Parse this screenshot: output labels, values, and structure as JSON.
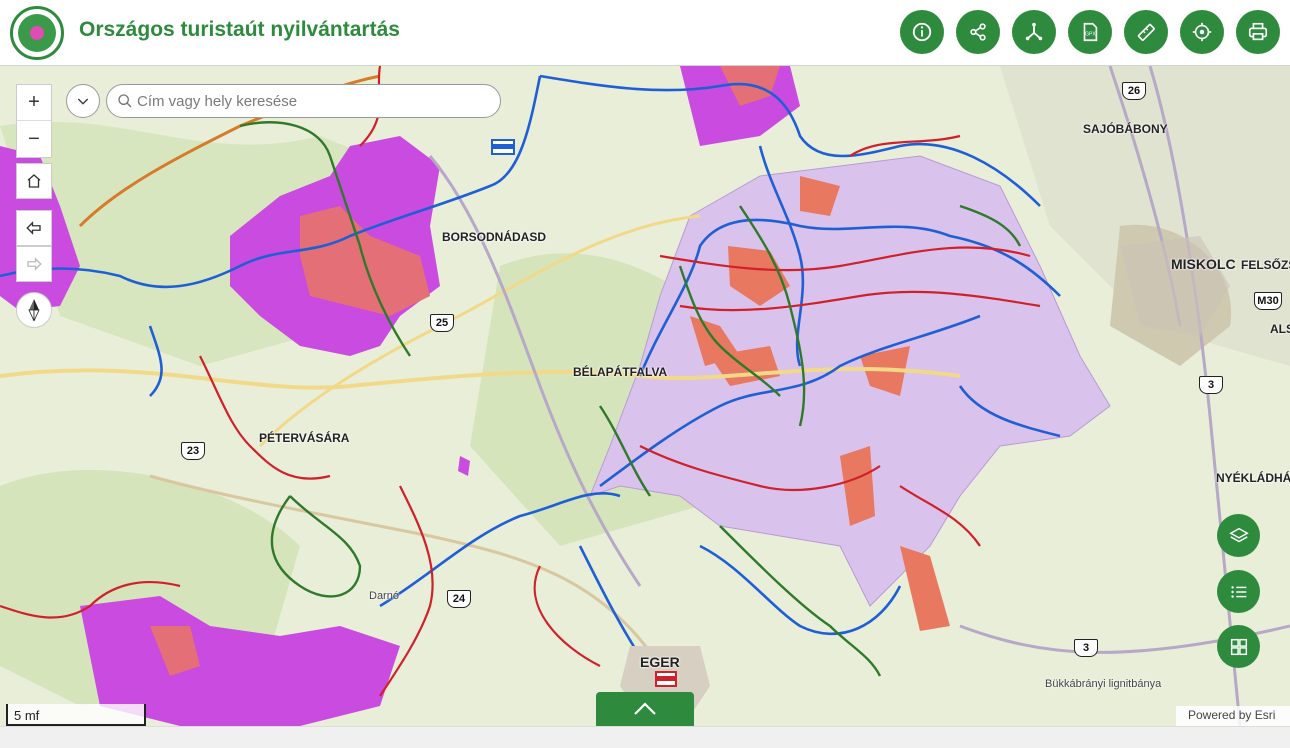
{
  "header": {
    "title": "Országos turistaút nyilvántartás",
    "tools": [
      {
        "name": "info",
        "icon": "info-icon"
      },
      {
        "name": "share",
        "icon": "share-icon"
      },
      {
        "name": "network",
        "icon": "route-network-icon"
      },
      {
        "name": "gpx",
        "icon": "gpx-file-icon",
        "label": "GPX"
      },
      {
        "name": "measure",
        "icon": "ruler-icon"
      },
      {
        "name": "locate",
        "icon": "locate-icon"
      },
      {
        "name": "print",
        "icon": "print-icon"
      }
    ]
  },
  "search": {
    "placeholder": "Cím vagy hely keresése"
  },
  "map_controls": {
    "zoom_in": "+",
    "zoom_out": "−"
  },
  "places": {
    "sajobabony": "SAJÓBÁBONY",
    "borsodnadasd": "BORSODNÁDASD",
    "miskolc": "MISKOLC",
    "felsozs": "FELSŐZS",
    "belapatfalva": "BÉLAPÁTFALVA",
    "petervasara": "PÉTERVÁSÁRA",
    "nyekladhaza": "NYÉKLÁDHÁZ",
    "eger": "EGER",
    "bukkabranyi": "Bükkábrányi lignitbánya",
    "darnó": "Darnó",
    "als": "ALS"
  },
  "roads": {
    "r26": "26",
    "r25": "25",
    "r23": "23",
    "r24": "24",
    "r3a": "3",
    "r3b": "3",
    "m30": "M30"
  },
  "scale": "5 mf",
  "attribution": "Powered by Esri",
  "colors": {
    "brand": "#2e8b3e",
    "trail_blue": "#1f5fd6",
    "trail_red": "#d0202a",
    "trail_green": "#2f7a2a",
    "reserve_purple": "#c24ad8",
    "reserve_light": "#d9c2ec",
    "reserve_core": "#e86a5a"
  }
}
